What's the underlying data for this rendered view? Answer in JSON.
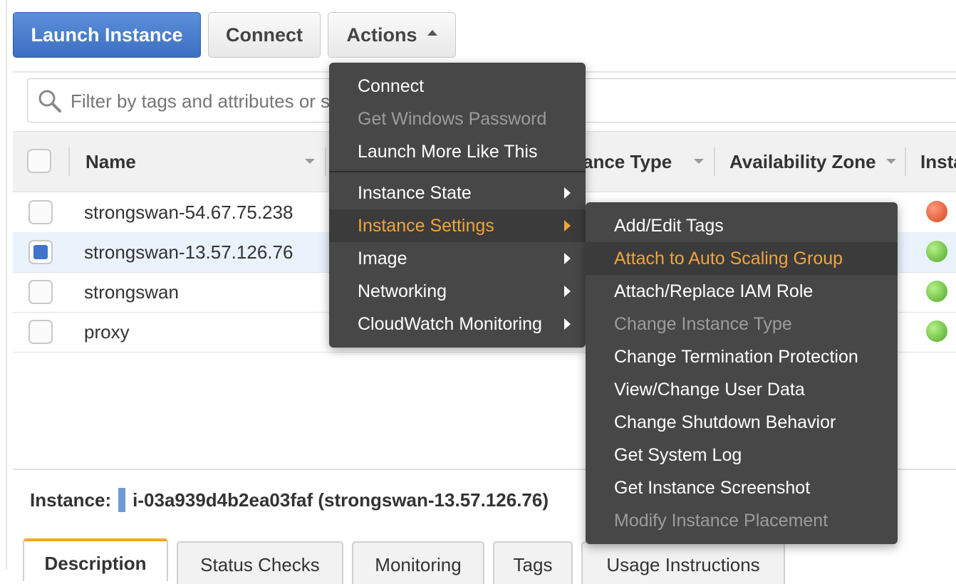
{
  "toolbar": {
    "launch_label": "Launch Instance",
    "connect_label": "Connect",
    "actions_label": "Actions"
  },
  "filter": {
    "placeholder": "Filter by tags and attributes or search by keyword"
  },
  "table": {
    "columns": [
      "Name",
      "Instance Type",
      "Availability Zone",
      "Instance State"
    ],
    "column_visible": [
      "Name",
      "ance Type",
      "Availability Zone",
      "Insta"
    ],
    "rows": [
      {
        "name": "strongswan-54.67.75.238",
        "selected": false,
        "status_color": "#d4451f",
        "status_glyph": "t"
      },
      {
        "name": "strongswan-13.57.126.76",
        "selected": true,
        "status_color": "#4ea723",
        "status_glyph": "r"
      },
      {
        "name": "strongswan",
        "selected": false,
        "status_color": "#4ea723",
        "status_glyph": "r"
      },
      {
        "name": "proxy",
        "selected": false,
        "status_color": "#4ea723",
        "status_glyph": "r"
      }
    ]
  },
  "instance_info": {
    "label": "Instance:",
    "value": "i-03a939d4b2ea03faf (strongswan-13.57.126.76)"
  },
  "tabs": [
    {
      "label": "Description",
      "active": true
    },
    {
      "label": "Status Checks",
      "active": false
    },
    {
      "label": "Monitoring",
      "active": false
    },
    {
      "label": "Tags",
      "active": false
    },
    {
      "label": "Usage Instructions",
      "active": false
    }
  ],
  "actions_menu": {
    "items": [
      {
        "label": "Connect",
        "disabled": false
      },
      {
        "label": "Get Windows Password",
        "disabled": true
      },
      {
        "label": "Launch More Like This",
        "disabled": false
      },
      {
        "label": "Instance State",
        "submenu": true
      },
      {
        "label": "Instance Settings",
        "submenu": true,
        "highlighted": true
      },
      {
        "label": "Image",
        "submenu": true
      },
      {
        "label": "Networking",
        "submenu": true
      },
      {
        "label": "CloudWatch Monitoring",
        "submenu": true
      }
    ]
  },
  "settings_submenu": {
    "items": [
      {
        "label": "Add/Edit Tags",
        "disabled": false
      },
      {
        "label": "Attach to Auto Scaling Group",
        "highlighted": true
      },
      {
        "label": "Attach/Replace IAM Role",
        "disabled": false
      },
      {
        "label": "Change Instance Type",
        "disabled": true
      },
      {
        "label": "Change Termination Protection",
        "disabled": false
      },
      {
        "label": "View/Change User Data",
        "disabled": false
      },
      {
        "label": "Change Shutdown Behavior",
        "disabled": false
      },
      {
        "label": "Get System Log",
        "disabled": false
      },
      {
        "label": "Get Instance Screenshot",
        "disabled": false
      },
      {
        "label": "Modify Instance Placement",
        "disabled": true
      }
    ]
  },
  "colors": {
    "primary_button": "#3c6fc2",
    "menu_bg": "#474747",
    "menu_highlight": "#f0a43a",
    "selected_row": "#eaf2fc",
    "active_tab_accent": "#f5a623"
  }
}
